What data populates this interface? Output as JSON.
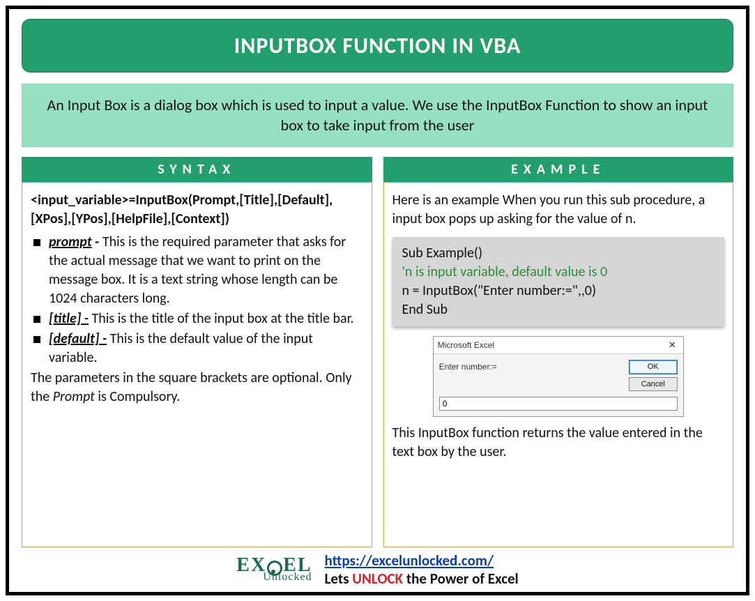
{
  "title": "INPUTBOX FUNCTION IN VBA",
  "intro": "An Input Box is a dialog box which is used to input a value. We use the InputBox Function to show an input box to take input from the user",
  "syntax": {
    "header": "SYNTAX",
    "signature": "<input_variable>=InputBox(Prompt,[Title],[Default],[XPos],[YPos],[HelpFile],[Context])",
    "params": [
      {
        "name": "prompt",
        "desc": "This is the required parameter that asks for the actual message that we want to print on the message box. It is a text string whose length can be 1024 characters long."
      },
      {
        "name": "[title] -",
        "desc": "This is the title of the input box at the title bar."
      },
      {
        "name": "[default] -",
        "desc": "This is the default value of the input variable."
      }
    ],
    "note_pre": "The parameters in the square brackets are optional. Only the ",
    "note_em": "Prompt",
    "note_post": " is Compulsory."
  },
  "example": {
    "header": "EXAMPLE",
    "intro": "Here is an example When you run this sub procedure, a input box pops up asking for the value of n.",
    "code": {
      "l1": "Sub Example()",
      "l2": "'n is input variable, default value is 0",
      "l3": "n = InputBox(\"Enter number:=\",,0)",
      "l4": "End Sub"
    },
    "dialog": {
      "title": "Microsoft Excel",
      "prompt": "Enter number:=",
      "ok": "OK",
      "cancel": "Cancel",
      "value": "0"
    },
    "outro": "This InputBox function returns the value entered in the text box by the user."
  },
  "footer": {
    "logo_top_pre": "EX",
    "logo_top_post": "EL",
    "logo_bottom": "Unlocked",
    "url": "https://excelunlocked.com/",
    "tagline_pre": "Lets ",
    "tagline_strong": "UNLOCK",
    "tagline_post": " the Power of Excel"
  }
}
